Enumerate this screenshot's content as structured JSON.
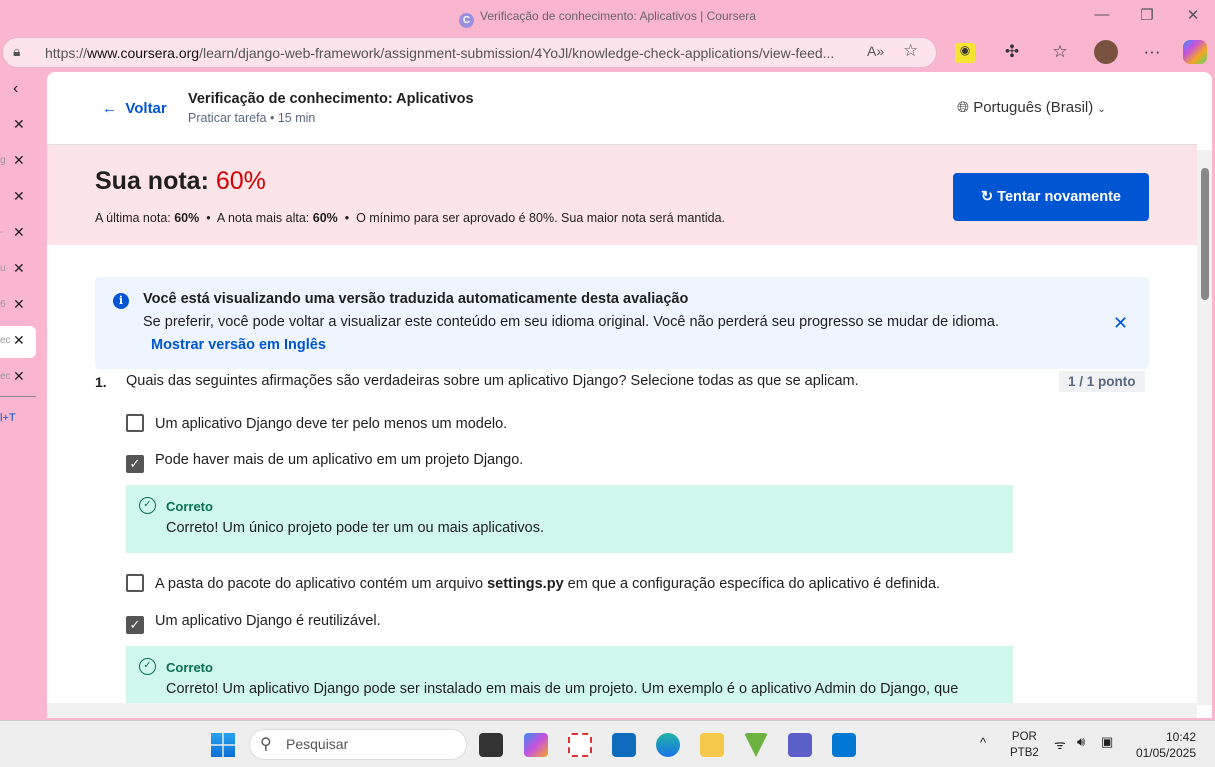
{
  "browser": {
    "tab_title": "Verificação de conhecimento: Aplicativos | Coursera",
    "url_prefix": "https://",
    "url_domain": "www.coursera.org",
    "url_path": "/learn/django-web-framework/assignment-submission/4YoJl/knowledge-check-applications/view-feed..."
  },
  "sidebar": {
    "tab_fragments": [
      "",
      "g",
      "",
      "-",
      "u",
      "6",
      "ec",
      "ec"
    ],
    "new_tab_hint": "l+T"
  },
  "header": {
    "back_label": "Voltar",
    "title": "Verificação de conhecimento: Aplicativos",
    "subtitle": "Praticar tarefa • 15 min",
    "language": "Português (Brasil)"
  },
  "score": {
    "label": "Sua nota:",
    "value": "60%",
    "last_label": "A última nota:",
    "last_value": "60%",
    "high_label": "A nota mais alta:",
    "high_value": "60%",
    "min_text": "O mínimo para ser aprovado é 80%. Sua maior nota será mantida.",
    "retry_label": "Tentar novamente"
  },
  "notice": {
    "title": "Você está visualizando uma versão traduzida automaticamente desta avaliação",
    "body": "Se preferir, você pode voltar a visualizar este conteúdo em seu idioma original. Você não perderá seu progresso se mudar de idioma.",
    "link": "Mostrar versão em Inglês"
  },
  "question": {
    "number": "1.",
    "text": "Quais das seguintes afirmações são verdadeiras sobre um aplicativo Django? Selecione todas as que se aplicam.",
    "points": "1 / 1 ponto",
    "options": [
      {
        "text": "Um aplicativo Django deve ter pelo menos um modelo.",
        "checked": false
      },
      {
        "text": "Pode haver mais de um aplicativo em um projeto Django.",
        "checked": true,
        "feedback_title": "Correto",
        "feedback": "Correto! Um único projeto pode ter um ou mais aplicativos."
      },
      {
        "text_before": "A pasta do pacote do aplicativo contém um arquivo ",
        "text_bold": "settings.py",
        "text_after": " em que a configuração específica do aplicativo é definida.",
        "checked": false
      },
      {
        "text": "Um aplicativo Django é reutilizável.",
        "checked": true,
        "feedback_title": "Correto",
        "feedback": "Correto! Um aplicativo Django pode ser instalado em mais de um projeto. Um exemplo é o aplicativo Admin do Django, que"
      }
    ]
  },
  "taskbar": {
    "search_placeholder": "Pesquisar",
    "lang1": "POR",
    "lang2": "PTB2",
    "time": "10:42",
    "date": "01/05/2025"
  },
  "colors": {
    "accent": "#0056d2",
    "score_red": "#d30001",
    "correct_bg": "#cff7ec",
    "correct_text": "#087051",
    "browser_frame": "#fbb6cf"
  }
}
